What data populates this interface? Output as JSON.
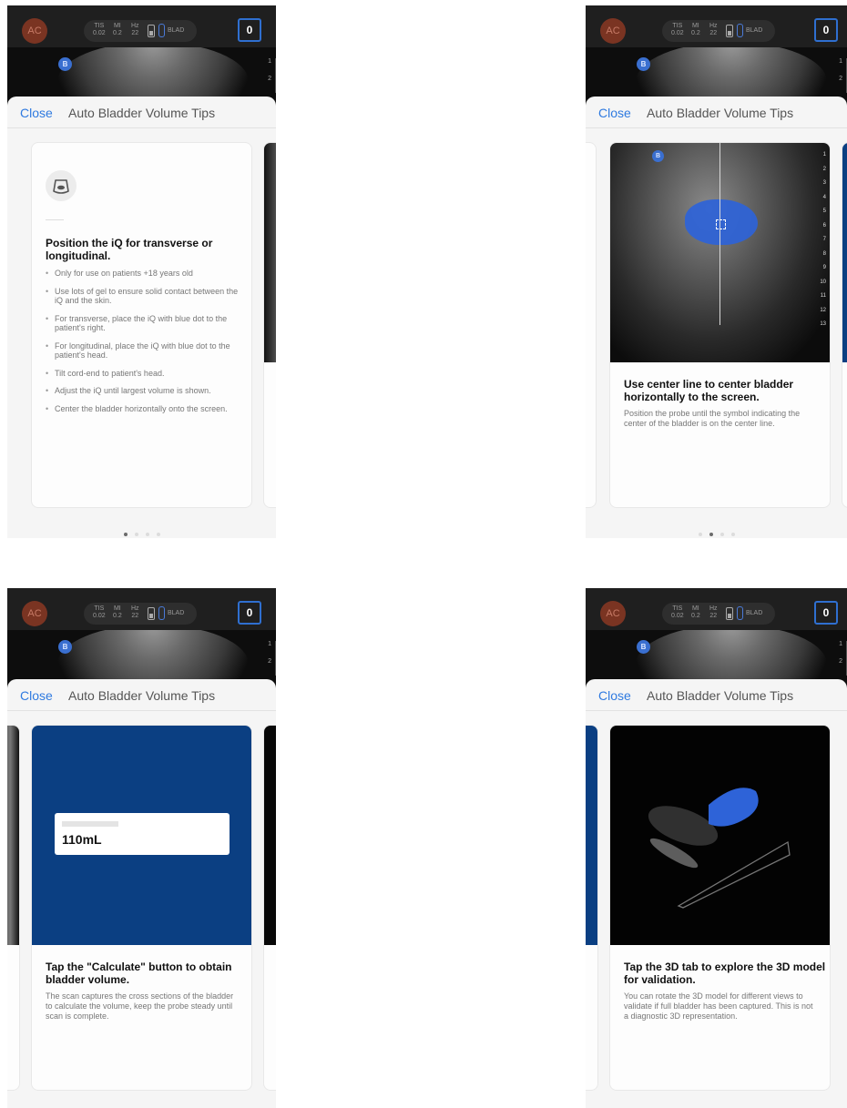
{
  "status_bar": {
    "avatar": "AC",
    "tis_label": "TIS",
    "tis_value": "0.02",
    "mi_label": "MI",
    "mi_value": "0.2",
    "hz_label": "Hz",
    "hz_value": "22",
    "preset": "BLAD",
    "counter": "0"
  },
  "image_marker": "B",
  "ruler_small": [
    "1",
    "2"
  ],
  "ruler_full": [
    "1",
    "2",
    "3",
    "4",
    "5",
    "6",
    "7",
    "8",
    "9",
    "10",
    "11",
    "12",
    "13"
  ],
  "sheet": {
    "close_label": "Close",
    "title": "Auto Bladder Volume Tips"
  },
  "cards": [
    {
      "heading": "Position the iQ for transverse or longitudinal.",
      "bullets": [
        "Only for use on patients +18 years old",
        "Use lots of gel to ensure solid contact between the iQ and the skin.",
        "For transverse, place the iQ with blue dot to the patient's right.",
        "For longitudinal, place the iQ with blue dot to the patient's head.",
        "Tilt cord-end to patient's head.",
        "Adjust the iQ until largest volume is shown.",
        "Center the bladder horizontally onto the screen."
      ]
    },
    {
      "heading": "Use center line to center bladder horizontally to the screen.",
      "body": "Position the probe until the symbol indicating the center of the bladder is on the center line."
    },
    {
      "heading": "Tap the \"Calculate\" button to obtain bladder volume.",
      "body": "The scan captures the cross sections of the bladder to calculate the volume, keep the probe steady until scan is complete.",
      "volume": "110mL"
    },
    {
      "heading": "Tap the 3D tab to explore the 3D model for validation.",
      "body": "You can rotate the 3D model for different views to validate if full bladder has been captured. This is not a diagnostic 3D representation."
    }
  ],
  "icons": {
    "probe": "probe-icon",
    "battery": "battery-icon",
    "thermometer": "thermometer-icon"
  },
  "colors": {
    "accent": "#2f7ae0",
    "card_blue": "#0b3f82",
    "bladder_blue": "#2e63d8"
  }
}
